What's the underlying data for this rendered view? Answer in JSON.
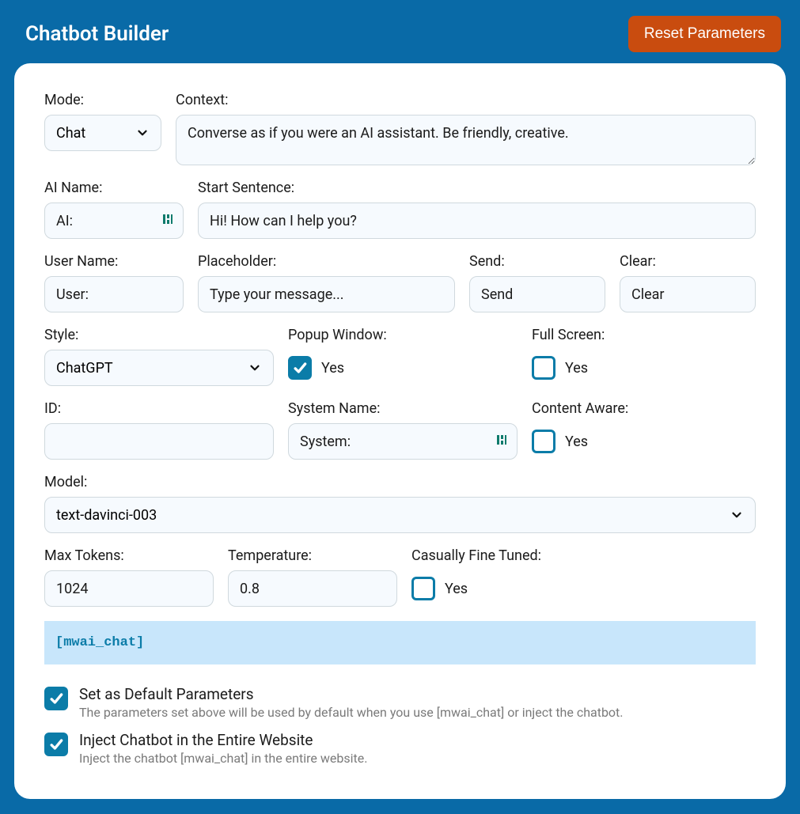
{
  "header": {
    "title": "Chatbot Builder",
    "reset_label": "Reset Parameters"
  },
  "labels": {
    "mode": "Mode:",
    "context": "Context:",
    "ai_name": "AI Name:",
    "start_sentence": "Start Sentence:",
    "user_name": "User Name:",
    "placeholder": "Placeholder:",
    "send": "Send:",
    "clear": "Clear:",
    "style": "Style:",
    "popup_window": "Popup Window:",
    "full_screen": "Full Screen:",
    "id": "ID:",
    "system_name": "System Name:",
    "content_aware": "Content Aware:",
    "model": "Model:",
    "max_tokens": "Max Tokens:",
    "temperature": "Temperature:",
    "casually_fine_tuned": "Casually Fine Tuned:"
  },
  "values": {
    "mode": "Chat",
    "context": "Converse as if you were an AI assistant. Be friendly, creative.",
    "ai_name": "AI:",
    "start_sentence": "Hi! How can I help you?",
    "user_name": "User:",
    "placeholder": "Type your message...",
    "send": "Send",
    "clear": "Clear",
    "style": "ChatGPT",
    "id": "",
    "system_name": "System:",
    "model": "text-davinci-003",
    "max_tokens": "1024",
    "temperature": "0.8"
  },
  "check_labels": {
    "yes": "Yes"
  },
  "shortcode": "[mwai_chat]",
  "options": {
    "default": {
      "title": "Set as Default Parameters",
      "sub": "The parameters set above will be used by default when you use [mwai_chat] or inject the chatbot."
    },
    "inject": {
      "title": "Inject Chatbot in the Entire Website",
      "sub": "Inject the chatbot [mwai_chat] in the entire website."
    }
  }
}
